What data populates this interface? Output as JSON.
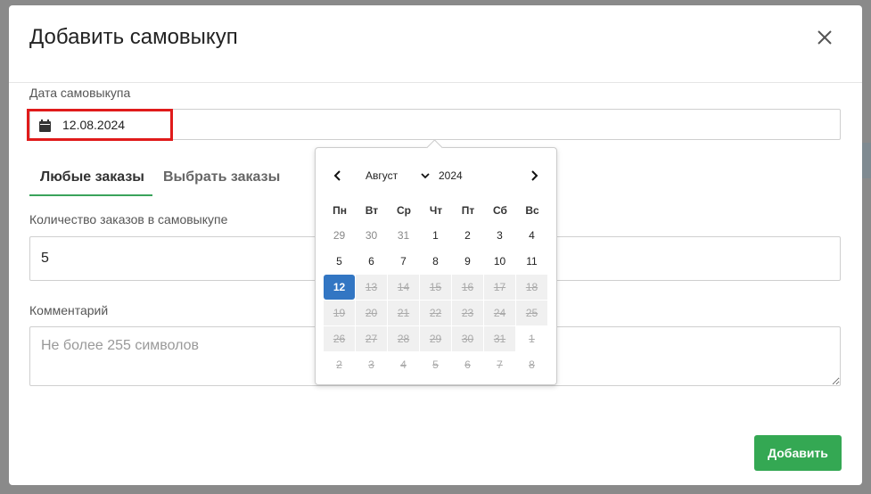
{
  "modal": {
    "title": "Добавить самовыкуп",
    "date_label": "Дата самовыкупа",
    "date_value": "12.08.2024",
    "tabs": [
      {
        "label": "Любые заказы",
        "active": true
      },
      {
        "label": "Выбрать заказы",
        "active": false
      }
    ],
    "count_label": "Количество заказов в самовыкупе",
    "count_value": "5",
    "comment_label": "Комментарий",
    "comment_placeholder": "Не более 255 символов",
    "submit_label": "Добавить"
  },
  "datepicker": {
    "month": "Август",
    "year": "2024",
    "weekdays": [
      "Пн",
      "Вт",
      "Ср",
      "Чт",
      "Пт",
      "Сб",
      "Вс"
    ],
    "days": [
      {
        "d": "29",
        "s": "other"
      },
      {
        "d": "30",
        "s": "other"
      },
      {
        "d": "31",
        "s": "other"
      },
      {
        "d": "1",
        "s": "normal"
      },
      {
        "d": "2",
        "s": "normal"
      },
      {
        "d": "3",
        "s": "normal"
      },
      {
        "d": "4",
        "s": "normal"
      },
      {
        "d": "5",
        "s": "normal"
      },
      {
        "d": "6",
        "s": "normal"
      },
      {
        "d": "7",
        "s": "normal"
      },
      {
        "d": "8",
        "s": "normal"
      },
      {
        "d": "9",
        "s": "normal"
      },
      {
        "d": "10",
        "s": "normal"
      },
      {
        "d": "11",
        "s": "normal"
      },
      {
        "d": "12",
        "s": "selected"
      },
      {
        "d": "13",
        "s": "disabled"
      },
      {
        "d": "14",
        "s": "disabled"
      },
      {
        "d": "15",
        "s": "disabled"
      },
      {
        "d": "16",
        "s": "disabled"
      },
      {
        "d": "17",
        "s": "disabled"
      },
      {
        "d": "18",
        "s": "disabled"
      },
      {
        "d": "19",
        "s": "disabled"
      },
      {
        "d": "20",
        "s": "disabled"
      },
      {
        "d": "21",
        "s": "disabled"
      },
      {
        "d": "22",
        "s": "disabled"
      },
      {
        "d": "23",
        "s": "disabled"
      },
      {
        "d": "24",
        "s": "disabled"
      },
      {
        "d": "25",
        "s": "disabled"
      },
      {
        "d": "26",
        "s": "disabled"
      },
      {
        "d": "27",
        "s": "disabled"
      },
      {
        "d": "28",
        "s": "disabled"
      },
      {
        "d": "29",
        "s": "disabled"
      },
      {
        "d": "30",
        "s": "disabled"
      },
      {
        "d": "31",
        "s": "disabled"
      },
      {
        "d": "1",
        "s": "disabled out"
      },
      {
        "d": "2",
        "s": "disabled out"
      },
      {
        "d": "3",
        "s": "disabled out"
      },
      {
        "d": "4",
        "s": "disabled out"
      },
      {
        "d": "5",
        "s": "disabled out"
      },
      {
        "d": "6",
        "s": "disabled out"
      },
      {
        "d": "7",
        "s": "disabled out"
      },
      {
        "d": "8",
        "s": "disabled out"
      }
    ]
  },
  "colors": {
    "accent_green": "#34a853",
    "selected_blue": "#3276c3",
    "highlight_red": "#e01b1b"
  }
}
